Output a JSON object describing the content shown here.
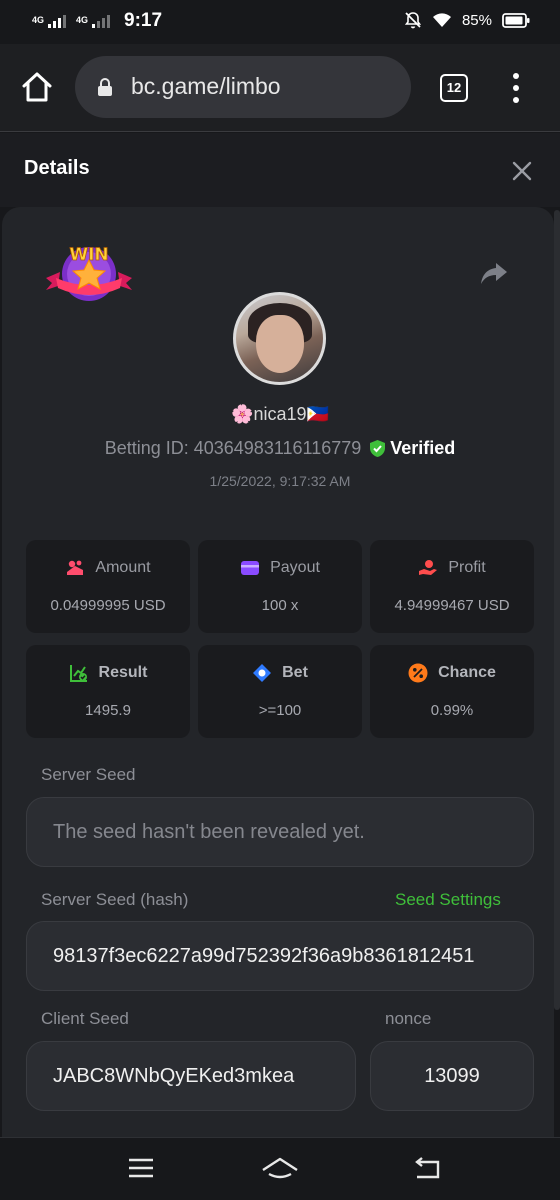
{
  "status_bar": {
    "net1": "4G",
    "net2": "4G",
    "time": "9:17",
    "battery": "85%"
  },
  "browser": {
    "url": "bc.game/limbo",
    "tab_count": "12"
  },
  "details": {
    "title": "Details"
  },
  "bet": {
    "badge": "WIN",
    "username": "🌸nica19🇵🇭",
    "betting_id": "Betting ID: 40364983116116779",
    "verified": "Verified",
    "datetime": "1/25/2022, 9:17:32 AM"
  },
  "stats": {
    "amount": {
      "label": "Amount",
      "value": "0.04999995 USD"
    },
    "payout": {
      "label": "Payout",
      "value": "100 x"
    },
    "profit": {
      "label": "Profit",
      "value": "4.94999467 USD"
    },
    "result": {
      "label": "Result",
      "value": "1495.9"
    },
    "bet": {
      "label": "Bet",
      "value": ">=100"
    },
    "chance": {
      "label": "Chance",
      "value": "0.99%"
    }
  },
  "seeds": {
    "server_seed_label": "Server Seed",
    "server_seed_value": "The seed hasn't been revealed yet.",
    "server_hash_label": "Server Seed (hash)",
    "seed_settings": "Seed Settings",
    "server_hash_value": "98137f3ec6227a99d752392f36a9b8361812451",
    "client_seed_label": "Client Seed",
    "client_seed_value": "JABC8WNbQyEKed3mkea",
    "nonce_label": "nonce",
    "nonce_value": "13099"
  },
  "colors": {
    "accent_green": "#3fbf3a",
    "card_bg": "#232529",
    "page_bg": "#17181b"
  }
}
